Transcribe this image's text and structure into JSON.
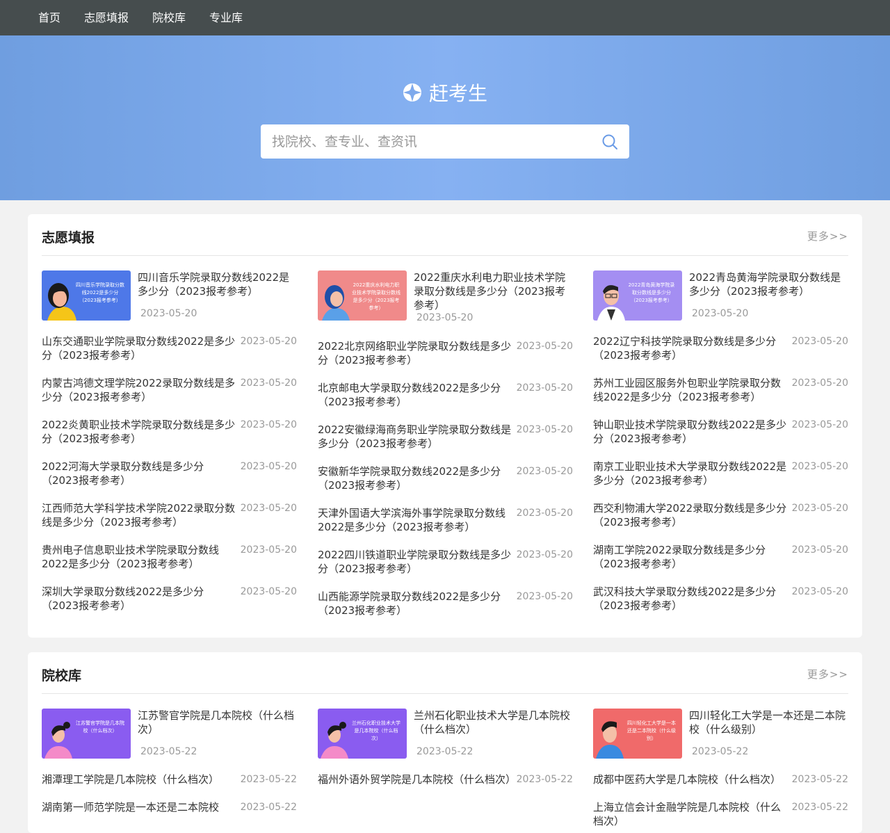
{
  "nav": [
    "首页",
    "志愿填报",
    "院校库",
    "专业库"
  ],
  "brand": {
    "name": "赶考生",
    "logo_icon": "compass-logo-icon"
  },
  "search": {
    "placeholder": "找院校、查专业、查资讯",
    "icon": "search-icon"
  },
  "section1": {
    "title": "志愿填报",
    "more": "更多>>",
    "columns": [
      {
        "featured": {
          "title": "四川音乐学院录取分数线2022是多少分（2023报考参考）",
          "date": "2023-05-20",
          "thumb_text": "四川音乐学院录取分数线2022是多少分（2023报考参考）",
          "thumb_color": "#4e78e8"
        },
        "items": [
          {
            "title": "山东交通职业学院录取分数线2022是多少分（2023报考参考）",
            "date": "2023-05-20"
          },
          {
            "title": "内蒙古鸿德文理学院2022录取分数线是多少分（2023报考参考）",
            "date": "2023-05-20"
          },
          {
            "title": "2022炎黄职业技术学院录取分数线是多少分（2023报考参考）",
            "date": "2023-05-20"
          },
          {
            "title": "2022河海大学录取分数线是多少分（2023报考参考）",
            "date": "2023-05-20"
          },
          {
            "title": "江西师范大学科学技术学院2022录取分数线是多少分（2023报考参考）",
            "date": "2023-05-20"
          },
          {
            "title": "贵州电子信息职业技术学院录取分数线2022是多少分（2023报考参考）",
            "date": "2023-05-20"
          },
          {
            "title": "深圳大学录取分数线2022是多少分（2023报考参考）",
            "date": "2023-05-20"
          }
        ]
      },
      {
        "featured": {
          "title": "2022重庆水利电力职业技术学院录取分数线是多少分（2023报考参考）",
          "date": "2023-05-20",
          "thumb_text": "2022重庆水利电力职业技术学院录取分数线是多少分（2023报考参考）",
          "thumb_color": "#f08a8a"
        },
        "items": [
          {
            "title": "2022北京网络职业学院录取分数线是多少分（2023报考参考）",
            "date": "2023-05-20"
          },
          {
            "title": "北京邮电大学录取分数线2022是多少分（2023报考参考）",
            "date": "2023-05-20"
          },
          {
            "title": "2022安徽绿海商务职业学院录取分数线是多少分（2023报考参考）",
            "date": "2023-05-20"
          },
          {
            "title": "安徽新华学院录取分数线2022是多少分（2023报考参考）",
            "date": "2023-05-20"
          },
          {
            "title": "天津外国语大学滨海外事学院录取分数线2022是多少分（2023报考参考）",
            "date": "2023-05-20"
          },
          {
            "title": "2022四川铁道职业学院录取分数线是多少分（2023报考参考）",
            "date": "2023-05-20"
          },
          {
            "title": "山西能源学院录取分数线2022是多少分（2023报考参考）",
            "date": "2023-05-20"
          }
        ]
      },
      {
        "featured": {
          "title": "2022青岛黄海学院录取分数线是多少分（2023报考参考）",
          "date": "2023-05-20",
          "thumb_text": "2022青岛黄海学院录取分数线是多少分（2023报考参考）",
          "thumb_color": "#a48ef2"
        },
        "items": [
          {
            "title": "2022辽宁科技学院录取分数线是多少分（2023报考参考）",
            "date": "2023-05-20"
          },
          {
            "title": "苏州工业园区服务外包职业学院录取分数线2022是多少分（2023报考参考）",
            "date": "2023-05-20"
          },
          {
            "title": "钟山职业技术学院录取分数线2022是多少分（2023报考参考）",
            "date": "2023-05-20"
          },
          {
            "title": "南京工业职业技术大学录取分数线2022是多少分（2023报考参考）",
            "date": "2023-05-20"
          },
          {
            "title": "西交利物浦大学2022录取分数线是多少分（2023报考参考）",
            "date": "2023-05-20"
          },
          {
            "title": "湖南工学院2022录取分数线是多少分（2023报考参考）",
            "date": "2023-05-20"
          },
          {
            "title": "武汉科技大学录取分数线2022是多少分（2023报考参考）",
            "date": "2023-05-20"
          }
        ]
      }
    ]
  },
  "section2": {
    "title": "院校库",
    "more": "更多>>",
    "columns": [
      {
        "featured": {
          "title": "江苏警官学院是几本院校（什么档次）",
          "date": "2023-05-22",
          "thumb_text": "江苏警官学院是几本院校（什么档次）",
          "thumb_color": "#8a5cf0"
        },
        "items": [
          {
            "title": "湘潭理工学院是几本院校（什么档次）",
            "date": "2023-05-22"
          },
          {
            "title": "湖南第一师范学院是一本还是二本院校",
            "date": "2023-05-22"
          }
        ]
      },
      {
        "featured": {
          "title": "兰州石化职业技术大学是几本院校（什么档次）",
          "date": "2023-05-22",
          "thumb_text": "兰州石化职业技术大学是几本院校（什么档次）",
          "thumb_color": "#8a5cf0"
        },
        "items": [
          {
            "title": "福州外语外贸学院是几本院校（什么档次）",
            "date": "2023-05-22"
          }
        ]
      },
      {
        "featured": {
          "title": "四川轻化工大学是一本还是二本院校（什么级别）",
          "date": "2023-05-22",
          "thumb_text": "四川轻化工大学是一本还是二本院校（什么级别）",
          "thumb_color": "#f06a6a"
        },
        "items": [
          {
            "title": "成都中医药大学是几本院校（什么档次）",
            "date": "2023-05-22"
          },
          {
            "title": "上海立信会计金融学院是几本院校（什么档次）",
            "date": "2023-05-22"
          }
        ]
      }
    ]
  }
}
